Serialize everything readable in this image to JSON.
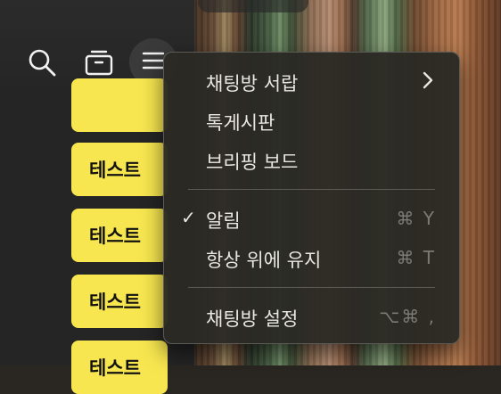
{
  "toolbar": {
    "search_icon": "search-icon",
    "archive_icon": "archive-icon",
    "menu_icon": "menu-icon"
  },
  "chat_list": {
    "items": [
      {
        "label": ""
      },
      {
        "label": "테스트"
      },
      {
        "label": "테스트"
      },
      {
        "label": "테스트"
      },
      {
        "label": "테스트"
      }
    ]
  },
  "menu": {
    "items": [
      {
        "label": "채팅방 서랍",
        "has_submenu": true
      },
      {
        "label": "톡게시판"
      },
      {
        "label": "브리핑 보드"
      },
      {
        "label": "알림",
        "checked": true,
        "check_glyph": "✓",
        "shortcut": "⌘ Y"
      },
      {
        "label": "항상 위에 유지",
        "shortcut": "⌘ T"
      },
      {
        "label": "채팅방 설정",
        "shortcut": "⌥⌘ ,"
      }
    ]
  },
  "colors": {
    "chat_item_bg": "#f7e64f",
    "menu_bg": "#2b2a24",
    "menu_text": "#e9e7e1",
    "shortcut_text": "#7b7a74"
  }
}
